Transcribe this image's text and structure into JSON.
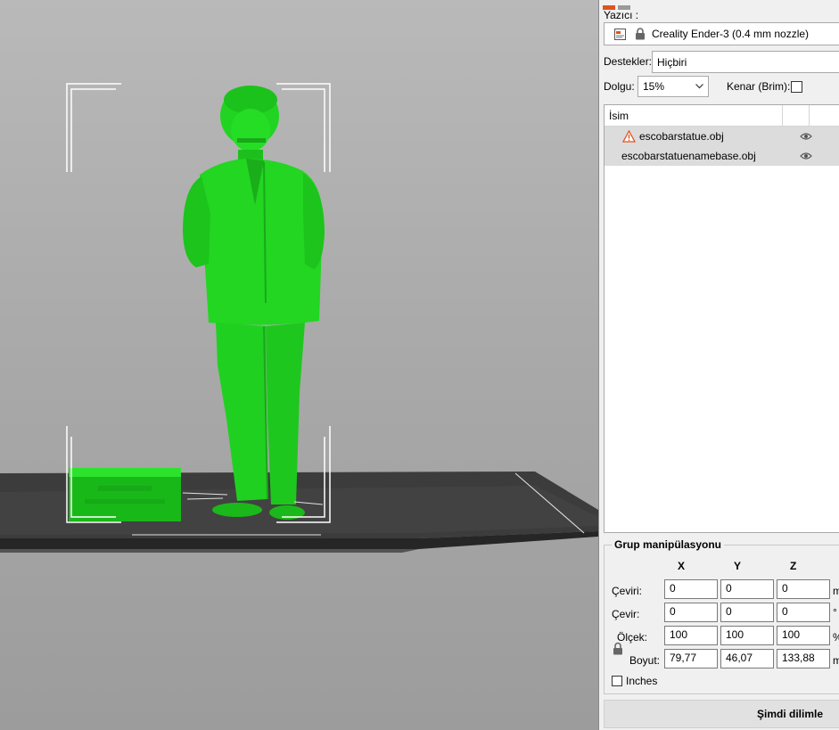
{
  "panel": {
    "printer_label": "Yazıcı :",
    "printer_value": "Creality Ender-3 (0.4 mm nozzle)",
    "supports_label": "Destekler:",
    "supports_value": "Hiçbiri",
    "infill_label": "Dolgu:",
    "infill_value": "15%",
    "brim_label": "Kenar (Brim):",
    "brim_checked": false
  },
  "objects": {
    "name_header": "İsim",
    "items": [
      {
        "name": "escobarstatue.obj",
        "warning": true,
        "visible": true
      },
      {
        "name": "escobarstatuenamebase.obj",
        "warning": false,
        "visible": true
      }
    ]
  },
  "group": {
    "title": "Grup manipülasyonu",
    "axes": [
      "X",
      "Y",
      "Z"
    ],
    "rows": [
      {
        "label": "Çeviri:",
        "values": [
          "0",
          "0",
          "0"
        ],
        "unit": "m"
      },
      {
        "label": "Çevir:",
        "values": [
          "0",
          "0",
          "0"
        ],
        "unit": "°"
      },
      {
        "label": "Ölçek:",
        "values": [
          "100",
          "100",
          "100"
        ],
        "unit": "%"
      },
      {
        "label": "Boyut:",
        "values": [
          "79,77",
          "46,07",
          "133,88"
        ],
        "unit": "m"
      }
    ],
    "inches_label": "Inches",
    "inches_checked": false
  },
  "slice_button": "Şimdi dilimle",
  "colors": {
    "model_green": "#1fd21f",
    "bed": "#3a3a3a",
    "panel_bg": "#f0f0f0",
    "warning": "#e0531f"
  }
}
